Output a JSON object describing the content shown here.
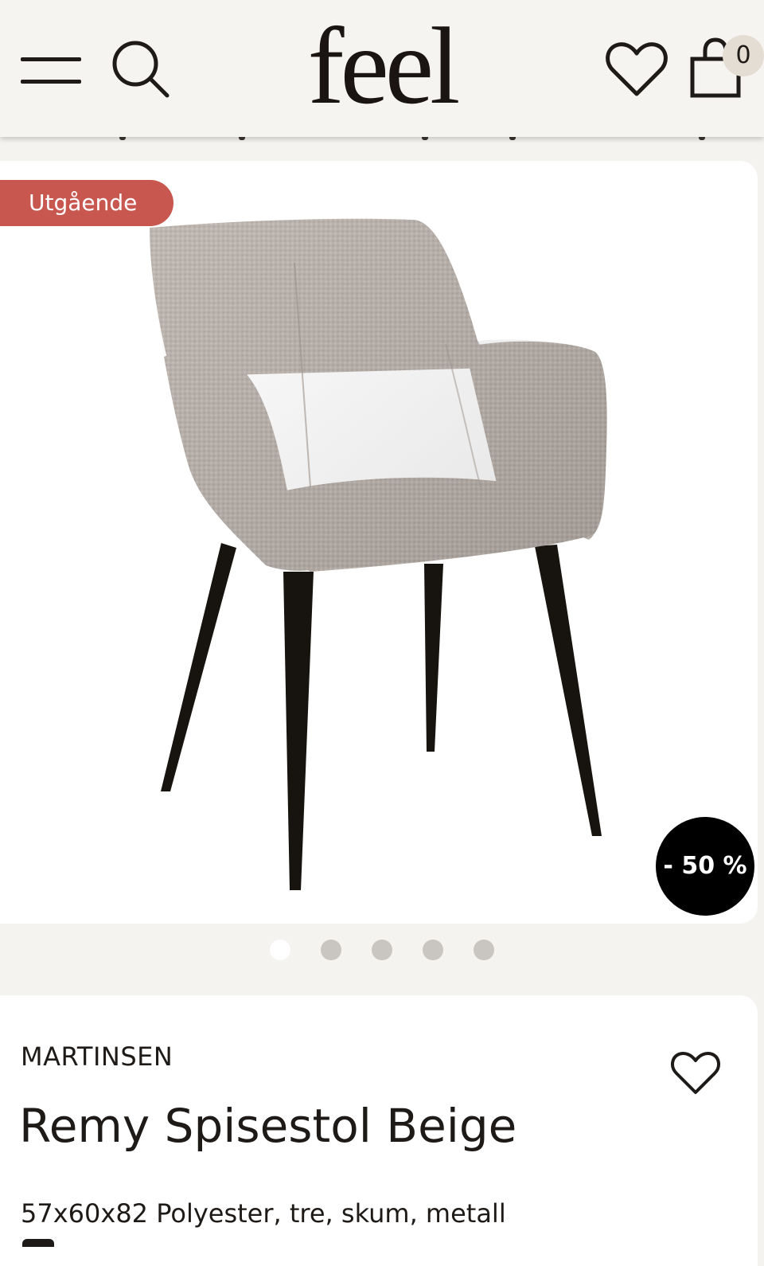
{
  "header": {
    "logo": "feel",
    "cart_count": "0",
    "icons": {
      "menu": "hamburger-menu-icon",
      "search": "search-icon",
      "wishlist": "heart-icon",
      "cart": "shopping-bag-icon"
    }
  },
  "product_gallery": {
    "status_badge": "Utgående",
    "discount_badge": "- 50 %",
    "image_alt": "chair-photo",
    "slide_count": 5,
    "active_slide": 1
  },
  "product": {
    "brand": "MARTINSEN",
    "title": "Remy Spisestol Beige",
    "specs": "57x60x82 Polyester, tre, skum, metall"
  },
  "colors": {
    "badge_red": "#c8574f",
    "discount_black": "#000000",
    "page_bg": "#f5f3ef",
    "text": "#1e1a17",
    "fabric": "#b9b0aa",
    "legs": "#17130f"
  }
}
